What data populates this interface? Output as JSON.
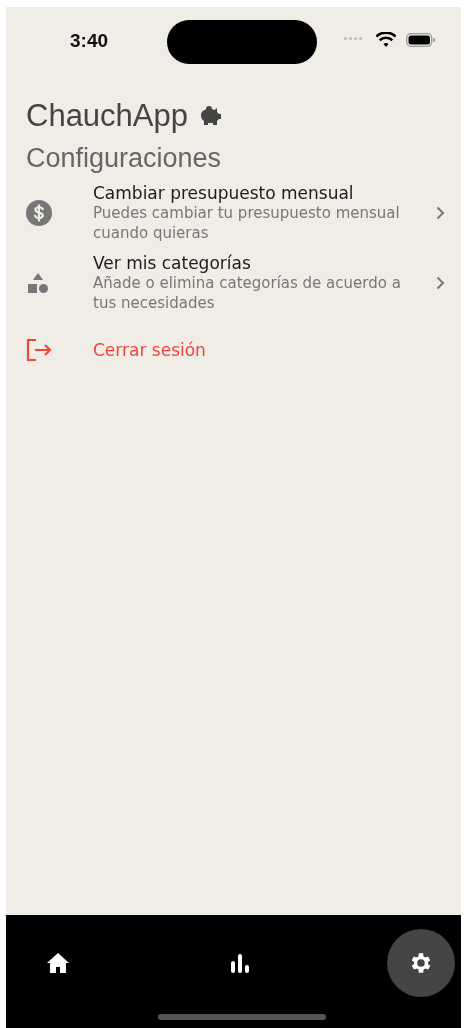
{
  "status_bar": {
    "time": "3:40"
  },
  "app_title": "ChauchApp",
  "page_title": "Configuraciones",
  "settings": [
    {
      "kind": "budget",
      "title": "Cambiar presupuesto mensual",
      "subtitle": "Puedes cambiar tu presupuesto mensual cuando quieras"
    },
    {
      "kind": "categories",
      "title": "Ver mis categorías",
      "subtitle": "Añade o elimina categorías de acuerdo a tus necesidades"
    },
    {
      "kind": "logout",
      "title": "Cerrar sesión"
    }
  ],
  "tabs": [
    {
      "kind": "home",
      "selected": false
    },
    {
      "kind": "stats",
      "selected": false
    },
    {
      "kind": "settings",
      "selected": true
    }
  ]
}
